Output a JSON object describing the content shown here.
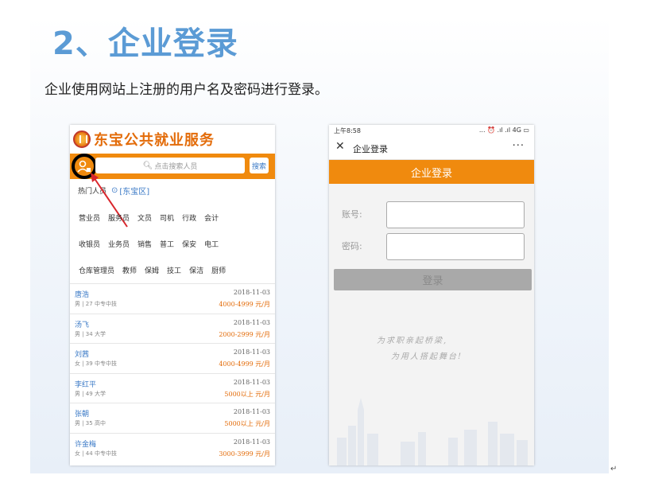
{
  "heading": "2、企业登录",
  "intro": "企业使用网站上注册的用户名及密码进行登录。",
  "return_mark": "↵",
  "left_phone": {
    "brand": "东宝公共就业服务",
    "search_placeholder": "点击搜索人员",
    "search_button": "搜索",
    "hot_label": "热门人员",
    "location": "[东宝区]",
    "tag_rows": [
      [
        "营业员",
        "服务员",
        "文员",
        "司机",
        "行政",
        "会计"
      ],
      [
        "收银员",
        "业务员",
        "销售",
        "普工",
        "保安",
        "电工"
      ],
      [
        "仓库管理员",
        "教师",
        "保姆",
        "技工",
        "保洁",
        "厨师"
      ]
    ],
    "people": [
      {
        "name": "唐浩",
        "meta": "男 | 27 中专中技",
        "date": "2018-11-03",
        "salary": "4000-4999 元/月"
      },
      {
        "name": "汤飞",
        "meta": "男 | 34 大学",
        "date": "2018-11-03",
        "salary": "2000-2999 元/月"
      },
      {
        "name": "刘茜",
        "meta": "女 | 39 中专中技",
        "date": "2018-11-03",
        "salary": "4000-4999 元/月"
      },
      {
        "name": "李红平",
        "meta": "男 | 49 大学",
        "date": "2018-11-03",
        "salary": "5000以上 元/月"
      },
      {
        "name": "张朝",
        "meta": "男 | 35 高中",
        "date": "2018-11-03",
        "salary": "5000以上 元/月"
      },
      {
        "name": "许金梅",
        "meta": "女 | 44 中专中技",
        "date": "2018-11-03",
        "salary": "3000-3999 元/月"
      }
    ]
  },
  "right_phone": {
    "status_time": "上午8:58",
    "status_indicators": "... ⏰ .ıl .ıl 4G ▭",
    "nav_close": "✕",
    "nav_title": "企业登录",
    "nav_more": "···",
    "header": "企业登录",
    "account_label": "账号:",
    "password_label": "密码:",
    "account_value": "",
    "password_value": "",
    "login_button": "登录",
    "slogan_line1": "为求职亲起桥梁,",
    "slogan_line2": "为用人搭起舞台!"
  },
  "colors": {
    "accent_orange": "#f08a0e",
    "title_blue": "#5b9bd5",
    "link_blue": "#3a79c6",
    "salary_orange": "#e36c0a"
  },
  "icons": [
    "user-icon",
    "search-icon",
    "location-pin-icon",
    "close-icon",
    "more-icon"
  ]
}
